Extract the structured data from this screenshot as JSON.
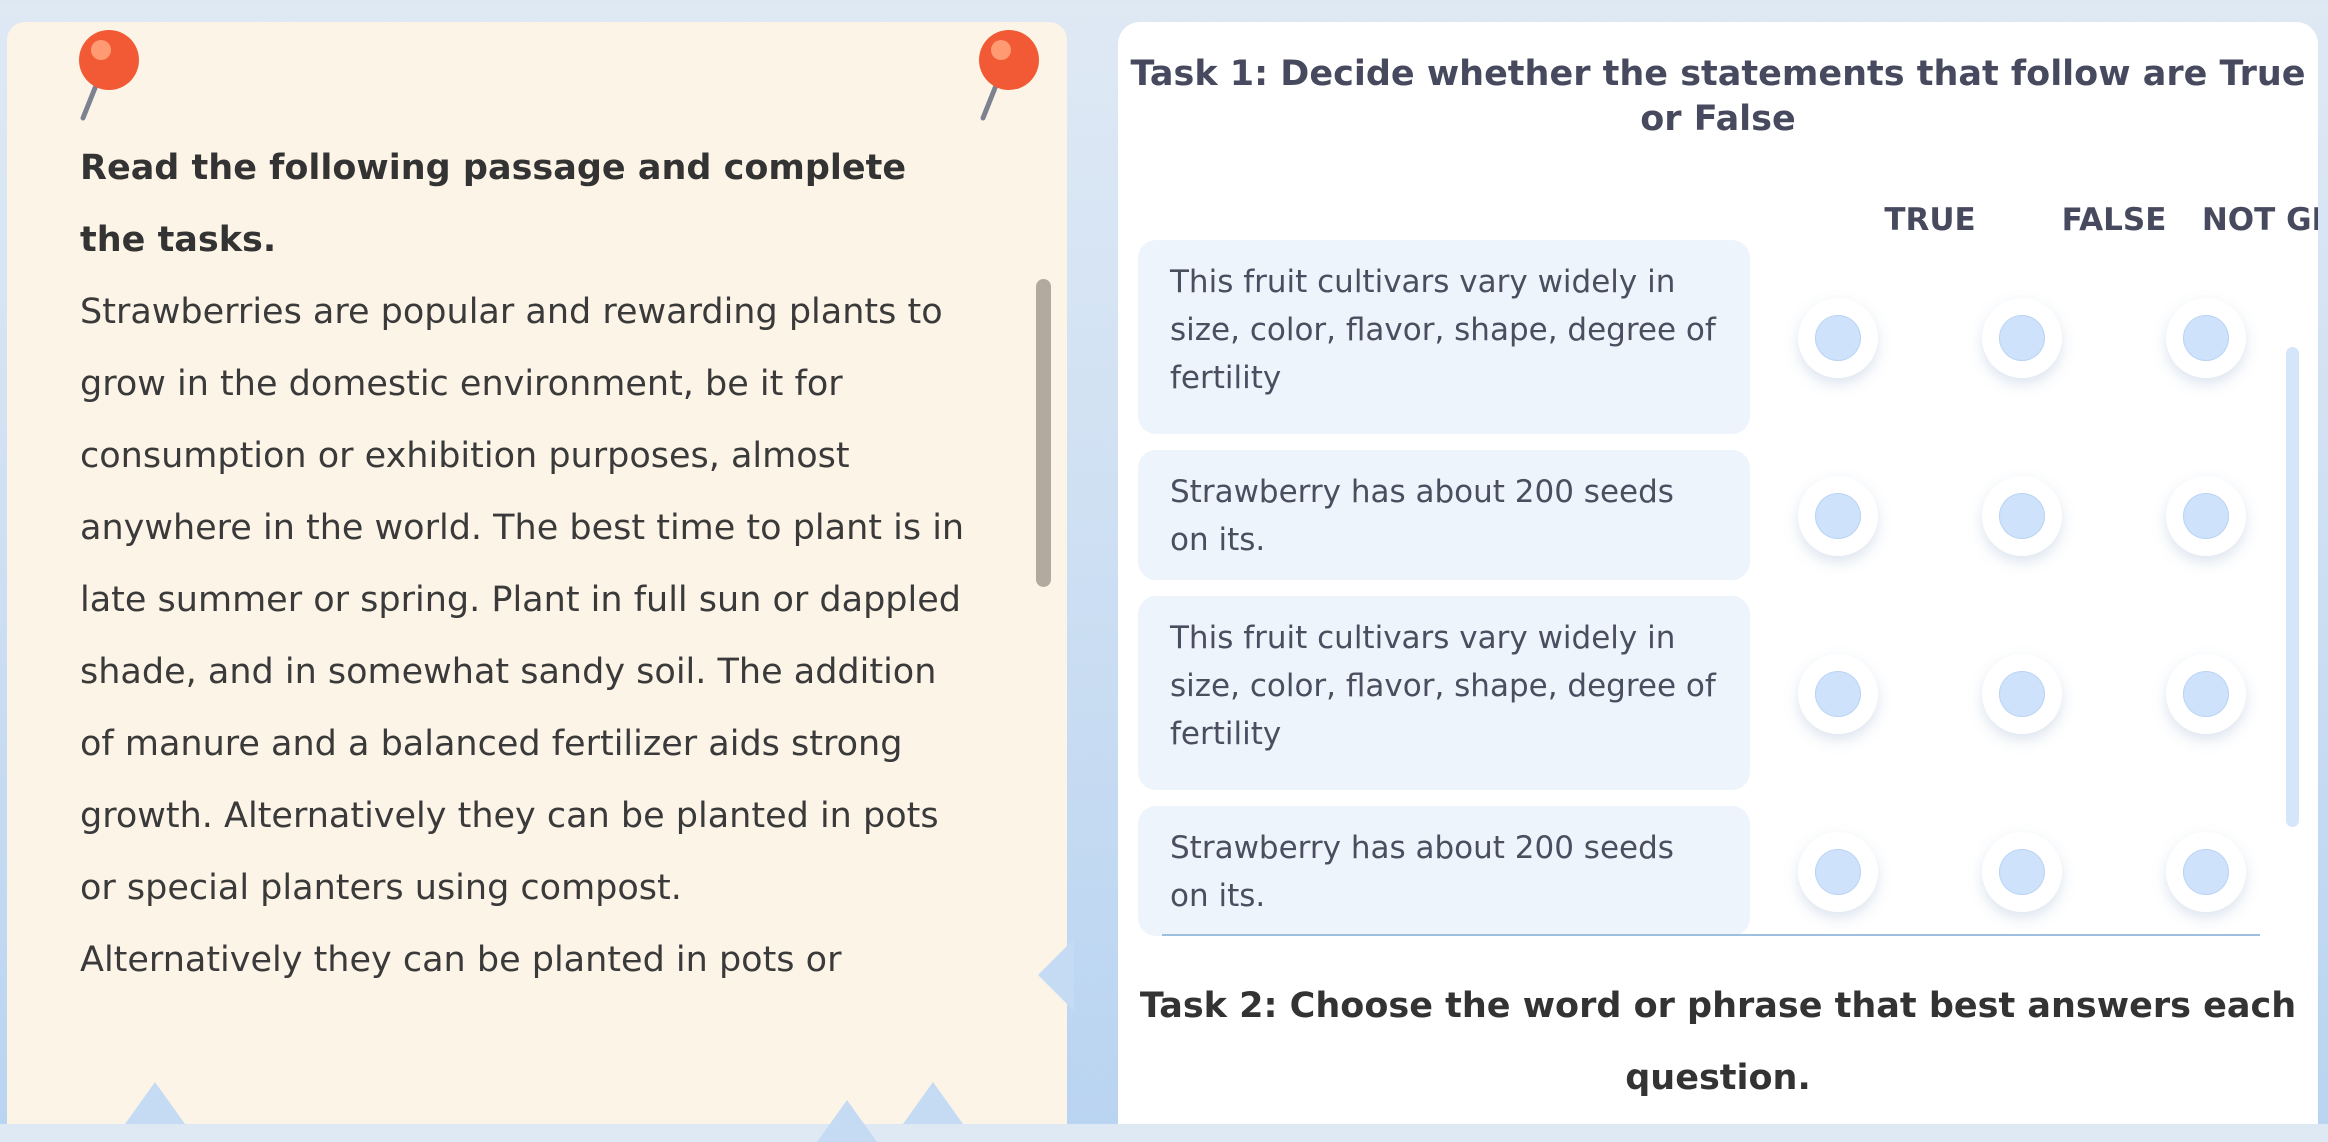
{
  "passage": {
    "instruction": "Read the following passage and complete the tasks.",
    "paragraphs": [
      "Strawberries are popular and rewarding plants to grow in the domestic environment, be it for consumption or exhibition purposes, almost anywhere in the world. The best time to plant is in late summer or spring. Plant in full sun or dappled shade, and in somewhat sandy soil. The addition of manure and a balanced fertilizer aids strong growth. Alternatively they can be planted in pots or special planters using compost.",
      "Alternatively they can be planted in pots or"
    ]
  },
  "task1": {
    "title": "Task 1: Decide whether the statements that follow are True or False",
    "columns": [
      "TRUE",
      "FALSE",
      "NOT GIVEN"
    ],
    "statements": [
      "This fruit cultivars vary widely in size, color, flavor, shape, degree of fertility",
      "Strawberry has about 200 seeds on its.",
      "This fruit cultivars vary widely in size, color, flavor, shape, degree of fertility",
      "Strawberry has about 200 seeds on its."
    ]
  },
  "task2": {
    "title": "Task 2: Choose the word or phrase that best answers each question."
  },
  "colors": {
    "passage_bg": "#fdf4e8",
    "pin": "#f15a35",
    "statement_bg": "#eef4fc",
    "radio_fill": "#cfe2fb"
  },
  "icons": [
    "pushpin-icon"
  ]
}
